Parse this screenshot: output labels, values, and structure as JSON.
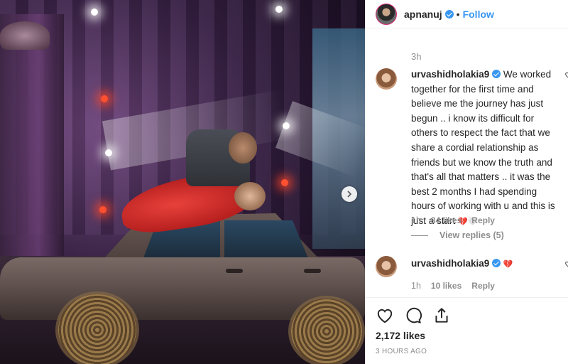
{
  "post": {
    "author": "apnanuj",
    "follow_label": "Follow",
    "separator": "•",
    "time": "3h"
  },
  "comments": [
    {
      "username": "urvashidholakia9",
      "text": "We worked together for the first time and believe me the journey has just begun .. i know its difficult for others to respect the fact that we share a cordial relationship as friends but we know the truth and that's all that matters .. it was the best 2 months I had spending hours of working with u and this is just a start",
      "emoji": "💔🤍",
      "time": "1h",
      "likes": "34 likes",
      "reply_label": "Reply",
      "view_replies": "View replies (5)"
    },
    {
      "username": "urvashidholakia9",
      "emoji": "💔",
      "time": "1h",
      "likes": "10 likes",
      "reply_label": "Reply"
    }
  ],
  "footer": {
    "likes": "2,172 likes",
    "posted": "3 HOURS AGO"
  },
  "icons": {
    "like": "heart-icon",
    "comment": "comment-bubble-icon",
    "share": "share-icon",
    "next": "chevron-right-icon",
    "verified": "verified-badge-icon",
    "comment_like": "small-heart-icon"
  },
  "colors": {
    "accent": "#3897f0",
    "muted": "#8e8e8e",
    "text": "#262626"
  }
}
